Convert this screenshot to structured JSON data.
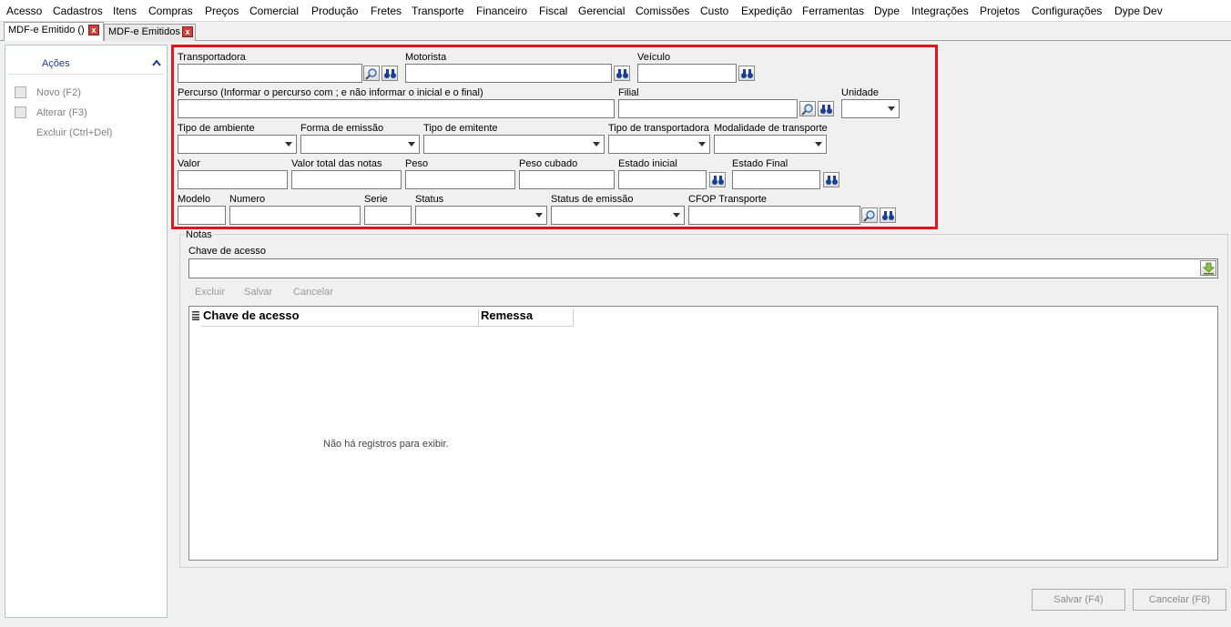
{
  "menu": [
    "Acesso",
    "Cadastros",
    "Itens",
    "Compras",
    "Preços",
    "Comercial",
    "Produção",
    "Fretes",
    "Transporte",
    "Financeiro",
    "Fiscal",
    "Gerencial",
    "Comissões",
    "Custo",
    "Expedição",
    "Ferramentas",
    "Dype",
    "Integrações",
    "Projetos",
    "Configurações",
    "Dype Dev"
  ],
  "tabs": [
    {
      "label": "MDF-e Emitido ()",
      "close": "x"
    },
    {
      "label": "MDF-e Emitidos",
      "close": "x"
    }
  ],
  "sidebar": {
    "title": "Ações",
    "actions": [
      "Novo (F2)",
      "Alterar (F3)",
      "Excluir (Ctrl+Del)"
    ]
  },
  "form": {
    "transportadora": {
      "label": "Transportadora",
      "value": ""
    },
    "motorista": {
      "label": "Motorista",
      "value": ""
    },
    "veiculo": {
      "label": "Veículo",
      "value": ""
    },
    "percurso": {
      "label": "Percurso (Informar o percurso com ; e não informar o inicial e o final)",
      "value": ""
    },
    "filial": {
      "label": "Filial",
      "value": ""
    },
    "unidade": {
      "label": "Unidade",
      "value": ""
    },
    "tipo_ambiente": {
      "label": "Tipo de ambiente",
      "value": ""
    },
    "forma_emissao": {
      "label": "Forma de emissão",
      "value": ""
    },
    "tipo_emitente": {
      "label": "Tipo de emitente",
      "value": ""
    },
    "tipo_transportadora": {
      "label": "Tipo de transportadora",
      "value": ""
    },
    "modalidade_transporte": {
      "label": "Modalidade de transporte",
      "value": ""
    },
    "valor": {
      "label": "Valor",
      "value": ""
    },
    "valor_total_notas": {
      "label": "Valor total das notas",
      "value": ""
    },
    "peso": {
      "label": "Peso",
      "value": ""
    },
    "peso_cubado": {
      "label": "Peso cubado",
      "value": ""
    },
    "estado_inicial": {
      "label": "Estado inicial",
      "value": ""
    },
    "estado_final": {
      "label": "Estado Final",
      "value": ""
    },
    "modelo": {
      "label": "Modelo",
      "value": ""
    },
    "numero": {
      "label": "Numero",
      "value": ""
    },
    "serie": {
      "label": "Serie",
      "value": ""
    },
    "status": {
      "label": "Status",
      "value": ""
    },
    "status_emissao": {
      "label": "Status de emissão",
      "value": ""
    },
    "cfop_transporte": {
      "label": "CFOP Transporte",
      "value": ""
    }
  },
  "notas": {
    "group_label": "Notas",
    "chave_label": "Chave de acesso",
    "chave_value": "",
    "toolbar": [
      "Excluir",
      "Salvar",
      "Cancelar"
    ],
    "columns": [
      "Chave de acesso",
      "Remessa"
    ],
    "empty_message": "Não há registros para exibir."
  },
  "footer": {
    "save": "Salvar (F4)",
    "cancel": "Cancelar (F8)"
  },
  "colors": {
    "highlight": "#e0161f",
    "accent": "#1c3f94"
  }
}
